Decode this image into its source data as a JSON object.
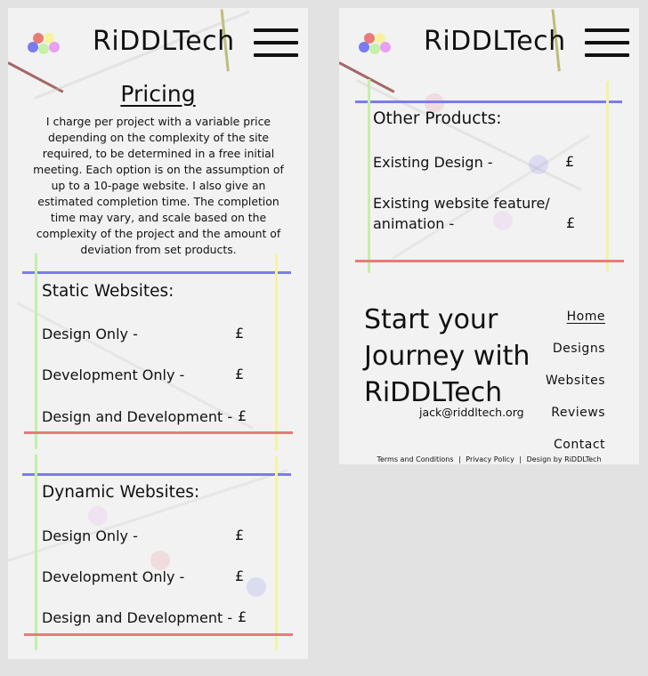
{
  "brand": {
    "name": "RiDDLTech"
  },
  "pricing": {
    "title": "Pricing",
    "intro": "I charge per project with a variable price depending on the complexity of the site required, to be determined in a free initial meeting. Each option is on the assumption of up to a 10-page website. I also give an estimated completion time. The completion time may vary, and scale based on the complexity of the project and the amount of deviation from set products."
  },
  "static_websites": {
    "title": "Static Websites:",
    "rows": [
      {
        "label": "Design Only -",
        "price": "£"
      },
      {
        "label": "Development Only -",
        "price": "£"
      },
      {
        "label": "Design and Development -",
        "price": "£"
      }
    ]
  },
  "dynamic_websites": {
    "title": "Dynamic Websites:",
    "rows": [
      {
        "label": "Design Only -",
        "price": "£"
      },
      {
        "label": "Development Only -",
        "price": "£"
      },
      {
        "label": "Design and Development -",
        "price": "£"
      }
    ]
  },
  "other_products": {
    "title": "Other Products:",
    "rows": [
      {
        "label": "Existing Design -",
        "price": "£"
      },
      {
        "label_line1": "Existing website feature/",
        "label_line2": "animation -",
        "price": "£"
      }
    ]
  },
  "footer": {
    "cta_line1": "Start your",
    "cta_line2": "Journey with",
    "cta_line3": "RiDDLTech",
    "email": "jack@riddltech.org",
    "nav": [
      "Home",
      "Designs",
      "Websites",
      "Reviews",
      "Contact"
    ],
    "legal": [
      "Terms and Conditions",
      "Privacy Policy",
      "Design by RiDDLTech"
    ],
    "legal_separator": "|"
  },
  "colors": {
    "page_bg": "#e2e2e2",
    "panel_bg": "#f2f2f2",
    "border_top": "#7b7bf0",
    "border_bottom": "#e87b78",
    "border_left": "#c4f0a8",
    "border_right": "#f5f3a0",
    "logo_dots": [
      "#e87b78",
      "#f5f3a0",
      "#7b7bf0",
      "#c4f0a8",
      "#e8a0f0"
    ]
  },
  "icons": {
    "logo": "rgb-dots-logo",
    "menu": "hamburger-menu-icon"
  }
}
